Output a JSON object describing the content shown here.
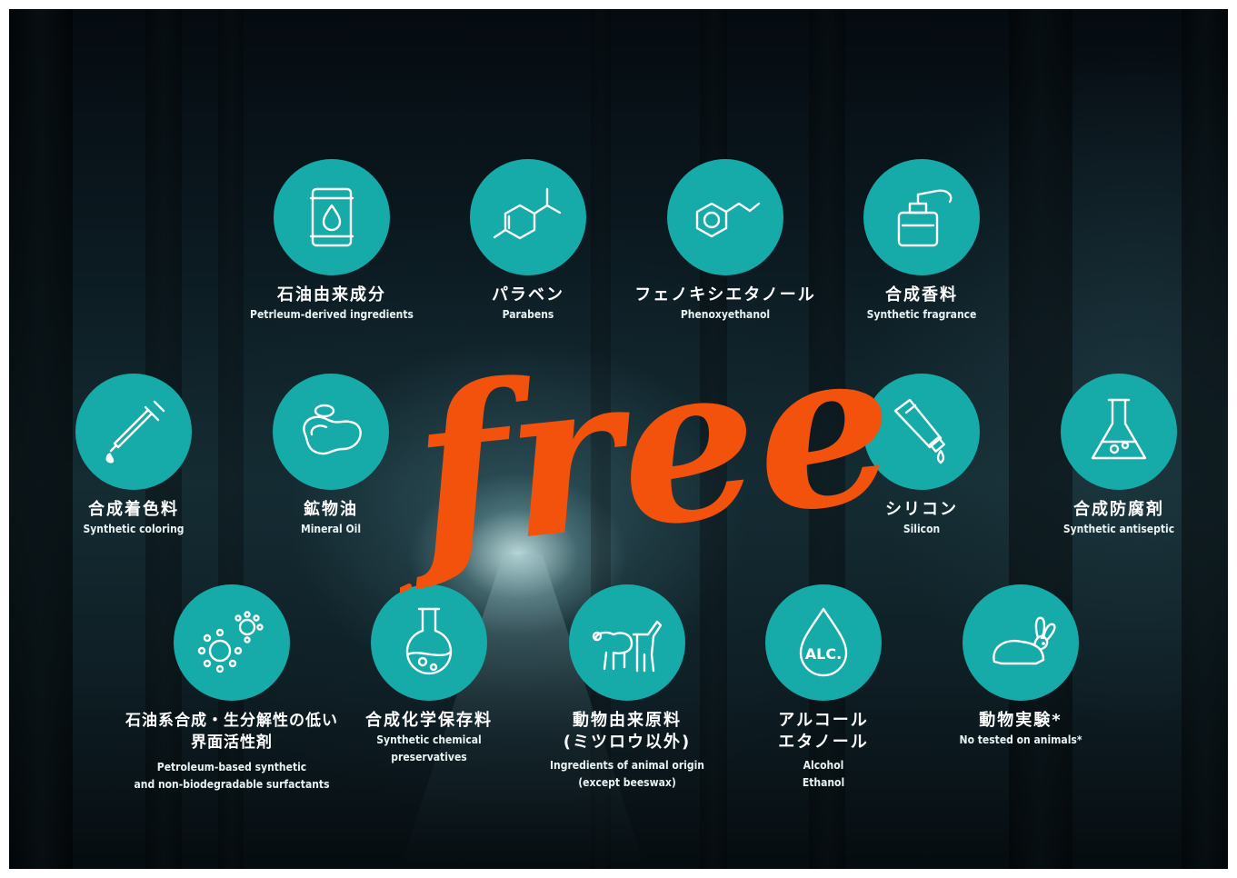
{
  "headline": "free",
  "colors": {
    "accent_circle": "#16aaa8",
    "headline": "#f2520b",
    "text": "#ffffff"
  },
  "items": [
    {
      "icon": "oil-barrel-icon",
      "jp": "石油由来成分",
      "en": [
        "Petrleum-derived ingredients"
      ]
    },
    {
      "icon": "paraben-molecule-icon",
      "jp": "パラベン",
      "en": [
        "Parabens"
      ]
    },
    {
      "icon": "phenoxyethanol-molecule-icon",
      "jp": "フェノキシエタノール",
      "en": [
        "Phenoxyethanol"
      ]
    },
    {
      "icon": "perfume-bottle-icon",
      "jp": "合成香料",
      "en": [
        "Synthetic fragrance"
      ]
    },
    {
      "icon": "dropper-icon",
      "jp": "合成着色料",
      "en": [
        "Synthetic coloring"
      ]
    },
    {
      "icon": "oil-puddle-icon",
      "jp": "鉱物油",
      "en": [
        "Mineral Oil"
      ]
    },
    {
      "icon": "silicone-tube-icon",
      "jp": "シリコン",
      "en": [
        "Silicon"
      ]
    },
    {
      "icon": "flask-icon",
      "jp": "合成防腐剤",
      "en": [
        "Synthetic antiseptic"
      ]
    },
    {
      "icon": "bacteria-icon",
      "jp": "石油系合成・生分解性の低い\n界面活性剤",
      "en": [
        "Petroleum-based synthetic",
        "and non-biodegradable surfactants"
      ]
    },
    {
      "icon": "round-flask-icon",
      "jp": "合成化学保存料",
      "en": [
        "Synthetic chemical",
        "preservatives"
      ]
    },
    {
      "icon": "sheep-horse-icon",
      "jp": "動物由来原料\n(ミツロウ以外)",
      "en": [
        "Ingredients of  animal origin",
        "(except beeswax)"
      ]
    },
    {
      "icon": "alcohol-drop-icon",
      "jp": "アルコール\nエタノール",
      "en": [
        "Alcohol",
        "Ethanol"
      ],
      "icon_label": "ALC."
    },
    {
      "icon": "rabbit-icon",
      "jp": "動物実験*",
      "en": [
        "No tested on animals*"
      ]
    }
  ]
}
